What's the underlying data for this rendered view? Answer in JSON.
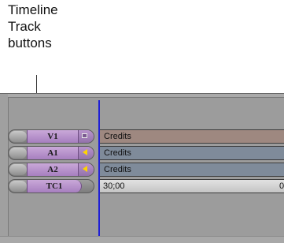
{
  "callout": {
    "text": "Timeline\nTrack\nbuttons"
  },
  "tracks": [
    {
      "label": "V1",
      "clip": "Credits"
    },
    {
      "label": "A1",
      "clip": "Credits"
    },
    {
      "label": "A2",
      "clip": "Credits"
    },
    {
      "label": "TC1",
      "timecode": "30;00",
      "timecode_next": "0"
    }
  ],
  "colors": {
    "track_button": "#b58ccb",
    "video_clip": "#9e8880",
    "audio_clip": "#7f8b9a",
    "position_indicator": "#1f1fd6",
    "audio_monitor_icon": "#ffd400"
  },
  "icons": {
    "video_monitor": "monitor-square-icon",
    "audio_monitor": "speaker-icon"
  }
}
